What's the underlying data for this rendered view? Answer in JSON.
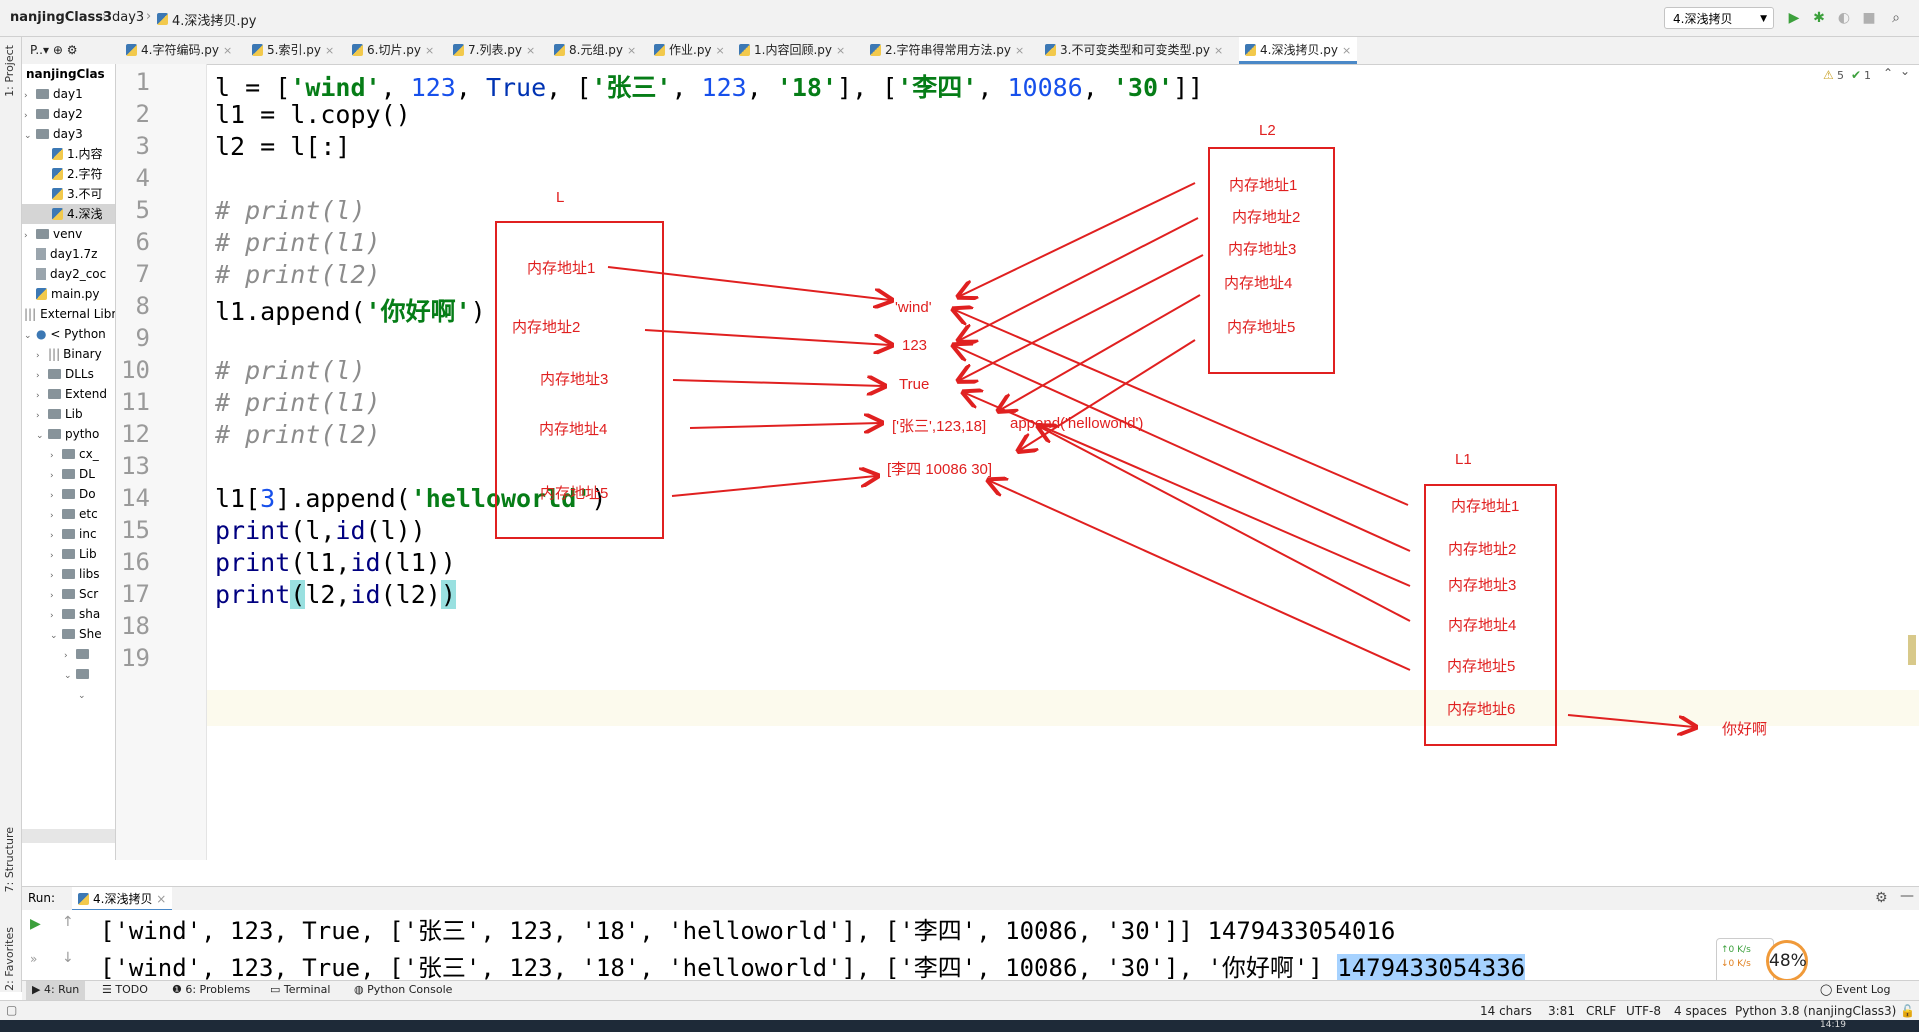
{
  "breadcrumb": [
    "nanjingClass3",
    "day3",
    "4.深浅拷贝.py"
  ],
  "run_config": "4.深浅拷贝",
  "left_strip": {
    "project": "1: Project",
    "structure": "7: Structure",
    "favorites": "2: Favorites"
  },
  "project_tree": [
    {
      "label": "P...▾",
      "level": 0
    },
    {
      "label": "nanjingClas",
      "level": 0,
      "bold": true
    },
    {
      "label": "day1",
      "level": 1,
      "type": "folder"
    },
    {
      "label": "day2",
      "level": 1,
      "type": "folder"
    },
    {
      "label": "day3",
      "level": 1,
      "type": "folder",
      "open": true
    },
    {
      "label": "1.内容",
      "level": 2,
      "type": "py"
    },
    {
      "label": "2.字符",
      "level": 2,
      "type": "py"
    },
    {
      "label": "3.不可",
      "level": 2,
      "type": "py"
    },
    {
      "label": "4.深浅",
      "level": 2,
      "type": "py",
      "selected": true
    },
    {
      "label": "venv",
      "level": 1,
      "type": "folder"
    },
    {
      "label": "day1.7z",
      "level": 1,
      "type": "zip"
    },
    {
      "label": "day2_coc",
      "level": 1,
      "type": "zip"
    },
    {
      "label": "main.py",
      "level": 1,
      "type": "py"
    },
    {
      "label": "External Libr",
      "level": 0
    },
    {
      "label": "< Python",
      "level": 1
    },
    {
      "label": "Binary",
      "level": 2,
      "type": "folder"
    },
    {
      "label": "DLLs",
      "level": 2,
      "type": "folder"
    },
    {
      "label": "Extend",
      "level": 2,
      "type": "folder"
    },
    {
      "label": "Lib",
      "level": 2,
      "type": "folder"
    },
    {
      "label": "pytho",
      "level": 2,
      "type": "folder",
      "open": true
    },
    {
      "label": "cx_",
      "level": 3,
      "type": "folder"
    },
    {
      "label": "DL",
      "level": 3,
      "type": "folder"
    },
    {
      "label": "Do",
      "level": 3,
      "type": "folder"
    },
    {
      "label": "etc",
      "level": 3,
      "type": "folder"
    },
    {
      "label": "inc",
      "level": 3,
      "type": "folder"
    },
    {
      "label": "Lib",
      "level": 3,
      "type": "folder"
    },
    {
      "label": "libs",
      "level": 3,
      "type": "folder"
    },
    {
      "label": "Scr",
      "level": 3,
      "type": "folder"
    },
    {
      "label": "sha",
      "level": 3,
      "type": "folder"
    },
    {
      "label": "She",
      "level": 3,
      "type": "folder",
      "open": true
    }
  ],
  "tabs": [
    "4.字符编码.py",
    "5.索引.py",
    "6.切片.py",
    "7.列表.py",
    "8.元组.py",
    "作业.py",
    "1.内容回顾.py",
    "2.字符串得常用方法.py",
    "3.不可变类型和可变类型.py",
    "4.深浅拷贝.py"
  ],
  "active_tab": "4.深浅拷贝.py",
  "inspection": {
    "warnings": "5",
    "ok": "1"
  },
  "line_numbers": [
    "1",
    "2",
    "3",
    "4",
    "5",
    "6",
    "7",
    "8",
    "9",
    "10",
    "11",
    "12",
    "13",
    "14",
    "15",
    "16",
    "17",
    "18",
    "19"
  ],
  "code": {
    "l1": "l = ['wind', 123, True, ['张三', 123, '18'], ['李四', 10086, '30']]",
    "l2": "l1 = l.copy()",
    "l3": "l2 = l[:]",
    "l5": "# print(l)",
    "l6": "# print(l1)",
    "l7": "# print(l2)",
    "l8": "l1.append('你好啊')",
    "l10": "# print(l)",
    "l11": "# print(l1)",
    "l12": "# print(l2)",
    "l14": "l1[3].append('helloworld')",
    "l15": "print(l,id(l))",
    "l16": "print(l1,id(l1))",
    "l17": "print(l2,id(l2))"
  },
  "annotations": {
    "L_title": "L",
    "L_items": [
      "内存地址1",
      "内存地址2",
      "内存地址3",
      "内存地址4",
      "内存地址5"
    ],
    "L2_title": "L2",
    "L2_items": [
      "内存地址1",
      "内存地址2",
      "内存地址3",
      "内存地址4",
      "内存地址5"
    ],
    "L1_title": "L1",
    "L1_items": [
      "内存地址1",
      "内存地址2",
      "内存地址3",
      "内存地址4",
      "内存地址5",
      "内存地址6"
    ],
    "values": [
      "'wind'",
      "123",
      "True",
      "['张三',123,18]",
      "[李四 10086  30]"
    ],
    "append_note": "append('helloworld')",
    "nihao": "你好啊"
  },
  "run": {
    "label": "Run:",
    "tab": "4.深浅拷贝",
    "output1": "['wind', 123, True, ['张三', 123, '18', 'helloworld'], ['李四', 10086, '30']] 1479433054016",
    "output2_text": "['wind', 123, True, ['张三', 123, '18', 'helloworld'], ['李四', 10086, '30'], '你好啊'] ",
    "output2_id": "1479433054336"
  },
  "bottom_tabs": [
    "4: Run",
    "TODO",
    "6: Problems",
    "Terminal",
    "Python Console"
  ],
  "event_log": "Event Log",
  "status": {
    "chars": "14 chars",
    "pos": "3:81",
    "crlf": "CRLF",
    "encoding": "UTF-8",
    "indent": "4 spaces",
    "interpreter": "Python 3.8 (nanjingClass3)"
  },
  "net": {
    "up": "0 K/s",
    "down": "0 K/s",
    "cpu": "48%"
  },
  "clock": "14:19",
  "colors": {
    "annotation": "#e02020",
    "string": "#067d17",
    "number": "#1750eb",
    "comment": "#8c8c8c",
    "builtin": "#000080",
    "selection": "#a6d2ff"
  }
}
